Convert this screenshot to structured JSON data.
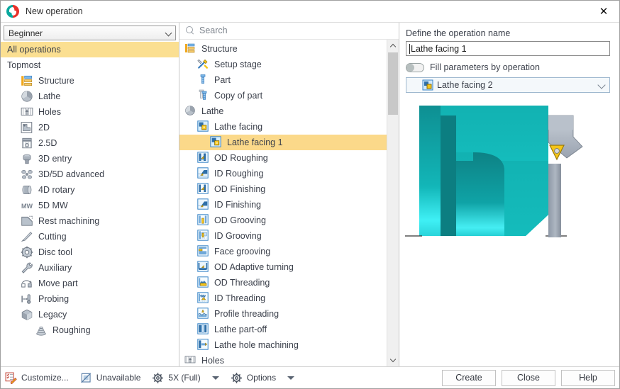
{
  "window": {
    "title": "New operation",
    "app_icon": "sprutcam-logo-icon",
    "close_label": "✕"
  },
  "left_panel": {
    "level_combo": {
      "value": "Beginner",
      "icon": "chevron-down-icon"
    },
    "items": [
      {
        "label": "All operations",
        "icon": "none",
        "indent": 0,
        "selected": true
      },
      {
        "label": "Topmost",
        "icon": "none",
        "indent": 0,
        "selected": false
      },
      {
        "label": "Structure",
        "icon": "structure-icon",
        "indent": 1,
        "selected": false
      },
      {
        "label": "Lathe",
        "icon": "lathe-icon",
        "indent": 1,
        "selected": false
      },
      {
        "label": "Holes",
        "icon": "holes-icon",
        "indent": 1,
        "selected": false
      },
      {
        "label": "2D",
        "icon": "twod-icon",
        "indent": 1,
        "selected": false
      },
      {
        "label": "2.5D",
        "icon": "twofived-icon",
        "indent": 1,
        "selected": false
      },
      {
        "label": "3D entry",
        "icon": "threed-entry-icon",
        "indent": 1,
        "selected": false
      },
      {
        "label": "3D/5D advanced",
        "icon": "threed-fived-icon",
        "indent": 1,
        "selected": false
      },
      {
        "label": "4D rotary",
        "icon": "fourd-rotary-icon",
        "indent": 1,
        "selected": false
      },
      {
        "label": "5D MW",
        "icon": "fived-mw-icon",
        "indent": 1,
        "selected": false
      },
      {
        "label": "Rest machining",
        "icon": "rest-machining-icon",
        "indent": 1,
        "selected": false
      },
      {
        "label": "Cutting",
        "icon": "cutting-icon",
        "indent": 1,
        "selected": false
      },
      {
        "label": "Disc tool",
        "icon": "disc-tool-icon",
        "indent": 1,
        "selected": false
      },
      {
        "label": "Auxiliary",
        "icon": "wrench-icon",
        "indent": 1,
        "selected": false
      },
      {
        "label": "Move part",
        "icon": "move-part-icon",
        "indent": 1,
        "selected": false
      },
      {
        "label": "Probing",
        "icon": "probing-icon",
        "indent": 1,
        "selected": false
      },
      {
        "label": "Legacy",
        "icon": "legacy-icon",
        "indent": 1,
        "selected": false
      },
      {
        "label": "Roughing",
        "icon": "roughing-icon",
        "indent": 2,
        "selected": false
      }
    ]
  },
  "middle_panel": {
    "search": {
      "placeholder": "Search",
      "icon": "search-icon",
      "value": ""
    },
    "tree": [
      {
        "label": "Structure",
        "icon": "structure-icon",
        "depth": 0,
        "selected": false
      },
      {
        "label": "Setup stage",
        "icon": "setup-stage-icon",
        "depth": 1,
        "selected": false
      },
      {
        "label": "Part",
        "icon": "part-icon",
        "depth": 1,
        "selected": false
      },
      {
        "label": "Copy of part",
        "icon": "copy-of-part-icon",
        "depth": 1,
        "selected": false
      },
      {
        "label": "Lathe",
        "icon": "lathe-icon",
        "depth": 0,
        "selected": false
      },
      {
        "label": "Lathe facing",
        "icon": "lathe-facing-icon",
        "depth": 1,
        "selected": false
      },
      {
        "label": "Lathe facing 1",
        "icon": "lathe-facing-icon",
        "depth": 2,
        "selected": true
      },
      {
        "label": "OD Roughing",
        "icon": "od-roughing-icon",
        "depth": 1,
        "selected": false
      },
      {
        "label": "ID Roughing",
        "icon": "id-roughing-icon",
        "depth": 1,
        "selected": false
      },
      {
        "label": "OD Finishing",
        "icon": "od-finishing-icon",
        "depth": 1,
        "selected": false
      },
      {
        "label": "ID Finishing",
        "icon": "id-finishing-icon",
        "depth": 1,
        "selected": false
      },
      {
        "label": "OD Grooving",
        "icon": "od-grooving-icon",
        "depth": 1,
        "selected": false
      },
      {
        "label": "ID Grooving",
        "icon": "id-grooving-icon",
        "depth": 1,
        "selected": false
      },
      {
        "label": "Face grooving",
        "icon": "face-grooving-icon",
        "depth": 1,
        "selected": false
      },
      {
        "label": "OD Adaptive turning",
        "icon": "od-adaptive-icon",
        "depth": 1,
        "selected": false
      },
      {
        "label": "OD Threading",
        "icon": "od-threading-icon",
        "depth": 1,
        "selected": false
      },
      {
        "label": "ID Threading",
        "icon": "id-threading-icon",
        "depth": 1,
        "selected": false
      },
      {
        "label": "Profile threading",
        "icon": "profile-thread-icon",
        "depth": 1,
        "selected": false
      },
      {
        "label": "Lathe part-off",
        "icon": "lathe-partoff-icon",
        "depth": 1,
        "selected": false
      },
      {
        "label": "Lathe hole machining",
        "icon": "lathe-hole-icon",
        "depth": 1,
        "selected": false
      },
      {
        "label": "Holes",
        "icon": "holes-icon",
        "depth": 0,
        "selected": false
      }
    ],
    "scrollbar": {
      "up_icon": "chevron-up-icon",
      "down_icon": "chevron-down-icon"
    }
  },
  "right_panel": {
    "name_label": "Define the operation name",
    "name_value": "Lathe facing 1",
    "fill_toggle": {
      "label": "Fill parameters by operation",
      "state": "off"
    },
    "operation_combo": {
      "value": "Lathe facing 2",
      "icon": "lathe-facing-icon",
      "chevron": "chevron-down-icon"
    },
    "preview": {
      "name": "lathe-facing-preview",
      "part_color": "#12b0b0",
      "highlight_color": "#22e8e8",
      "tool_color": "#9aa4b0",
      "insert_color": "#f5c518"
    }
  },
  "bottom_bar": {
    "items": [
      {
        "label": "Customize...",
        "icon": "customize-icon",
        "caret": false
      },
      {
        "label": "Unavailable",
        "icon": "unavailable-icon",
        "caret": false
      },
      {
        "label": "5X (Full)",
        "icon": "gear-icon",
        "caret": true
      },
      {
        "label": "Options",
        "icon": "gear-icon",
        "caret": true
      }
    ],
    "buttons": [
      {
        "label": "Create"
      },
      {
        "label": "Close"
      },
      {
        "label": "Help"
      }
    ]
  }
}
